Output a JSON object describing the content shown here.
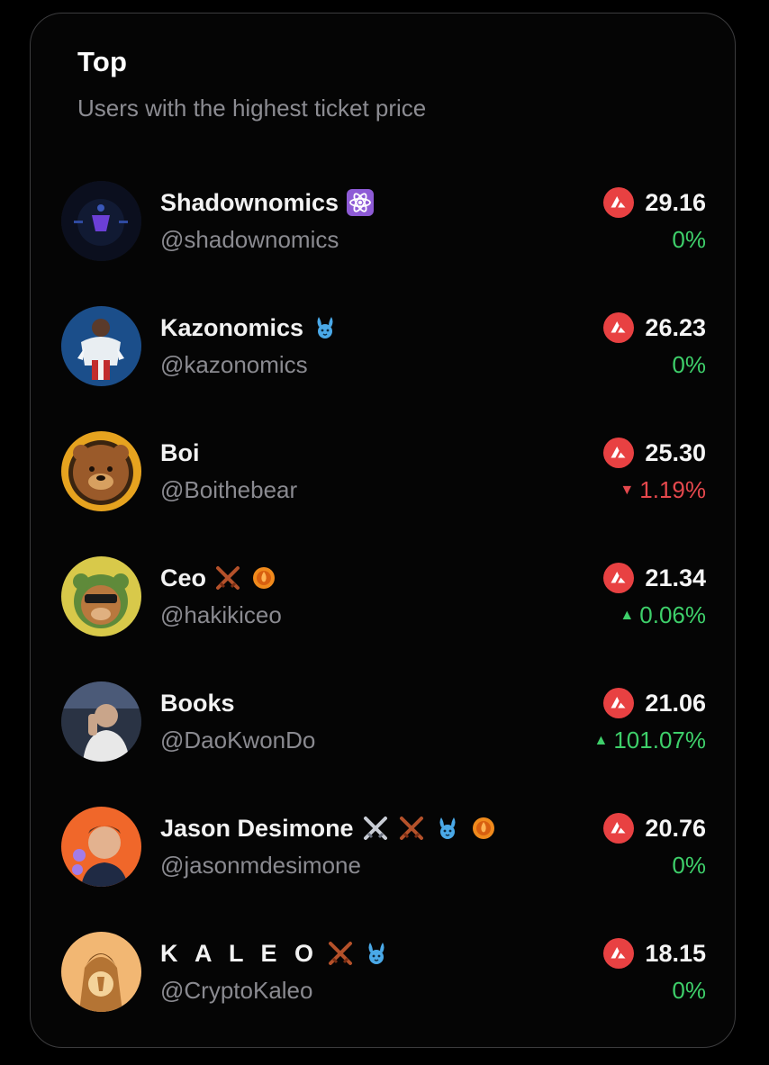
{
  "header": {
    "title": "Top",
    "subtitle": "Users with the highest ticket price"
  },
  "colors": {
    "background": "#000000",
    "card_border": "#3c3c3e",
    "text_primary": "#ffffff",
    "text_secondary": "#8a8a90",
    "avax_red": "#e84142",
    "positive": "#3ecf6a",
    "negative": "#e5484d"
  },
  "users": [
    {
      "name": "Shadownomics",
      "handle": "@shadownomics",
      "price": "29.16",
      "change": "0%",
      "direction": "flat",
      "badges": [
        "atom-emoji-icon"
      ]
    },
    {
      "name": "Kazonomics",
      "handle": "@kazonomics",
      "price": "26.23",
      "change": "0%",
      "direction": "flat",
      "badges": [
        "bunny-icon"
      ]
    },
    {
      "name": "Boi",
      "handle": "@Boithebear",
      "price": "25.30",
      "change": "1.19%",
      "direction": "down",
      "badges": []
    },
    {
      "name": "Ceo",
      "handle": "@hakikiceo",
      "price": "21.34",
      "change": "0.06%",
      "direction": "up",
      "badges": [
        "crossed-swords-bronze-icon",
        "orange-flame-coin-icon"
      ]
    },
    {
      "name": "Books",
      "handle": "@DaoKwonDo",
      "price": "21.06",
      "change": "101.07%",
      "direction": "up",
      "badges": []
    },
    {
      "name": "Jason Desimone",
      "handle": "@jasonmdesimone",
      "price": "20.76",
      "change": "0%",
      "direction": "flat",
      "badges": [
        "crossed-swords-silver-icon",
        "crossed-swords-bronze-icon",
        "bunny-icon",
        "orange-flame-coin-icon"
      ]
    },
    {
      "name": "K A L E O",
      "handle": "@CryptoKaleo",
      "price": "18.15",
      "change": "0%",
      "direction": "flat",
      "badges": [
        "crossed-swords-bronze-icon",
        "bunny-icon"
      ]
    }
  ],
  "icons": {
    "currency": "avax-icon",
    "up": "triangle-up-icon",
    "down": "triangle-down-icon"
  }
}
